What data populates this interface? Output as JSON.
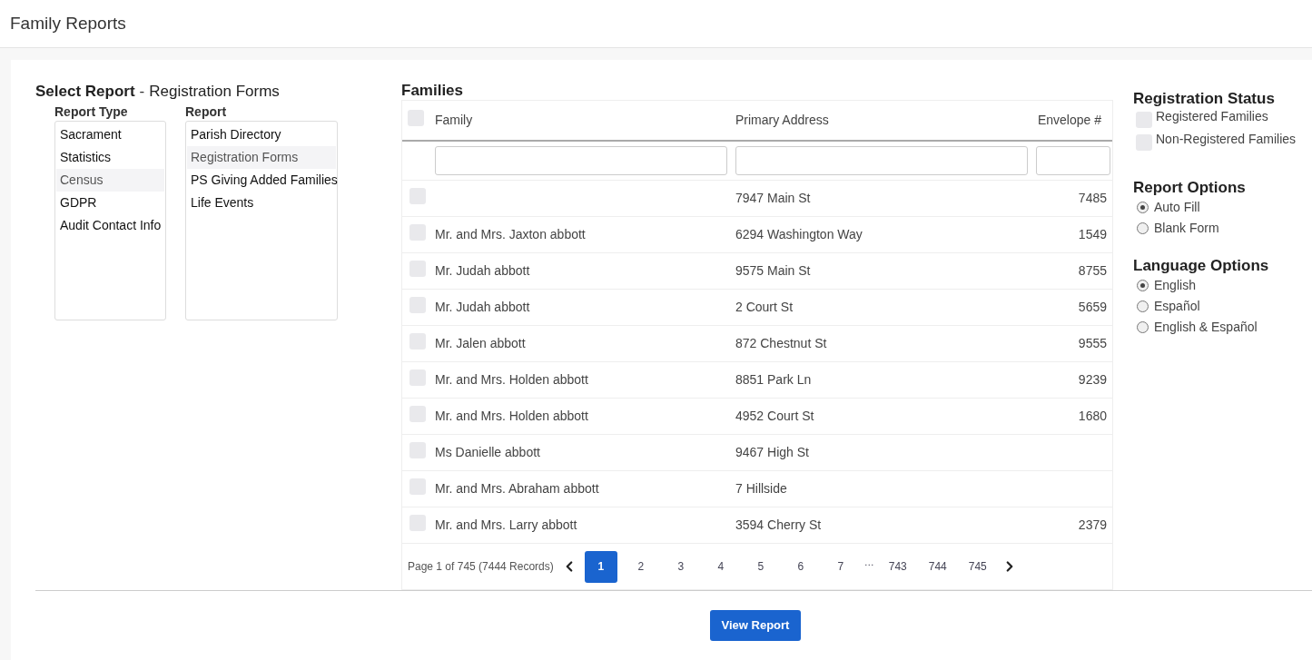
{
  "page_title": "Family Reports",
  "select_report": {
    "heading": "Select Report",
    "separator": "-",
    "current": "Registration Forms",
    "report_type": {
      "label": "Report Type",
      "items": [
        {
          "label": "Sacrament",
          "selected": false
        },
        {
          "label": "Statistics",
          "selected": false
        },
        {
          "label": "Census",
          "selected": true
        },
        {
          "label": "GDPR",
          "selected": false
        },
        {
          "label": "Audit Contact Info",
          "selected": false
        }
      ]
    },
    "report": {
      "label": "Report",
      "items": [
        {
          "label": "Parish Directory",
          "selected": false
        },
        {
          "label": "Registration Forms",
          "selected": true
        },
        {
          "label": "PS Giving Added Families",
          "selected": false
        },
        {
          "label": "Life Events",
          "selected": false
        }
      ]
    }
  },
  "families": {
    "title": "Families",
    "select_all_checked": false,
    "columns": [
      "Family",
      "Primary Address",
      "Envelope #"
    ],
    "rows": [
      {
        "family": "",
        "address": "7947 Main St",
        "envelope": "7485",
        "checked": false
      },
      {
        "family": "Mr. and Mrs. Jaxton abbott",
        "address": "6294 Washington Way",
        "envelope": "1549",
        "checked": false
      },
      {
        "family": "Mr. Judah abbott",
        "address": "9575 Main St",
        "envelope": "8755",
        "checked": false
      },
      {
        "family": "Mr. Judah abbott",
        "address": "2 Court St",
        "envelope": "5659",
        "checked": false
      },
      {
        "family": "Mr. Jalen abbott",
        "address": "872 Chestnut St",
        "envelope": "9555",
        "checked": false
      },
      {
        "family": "Mr. and Mrs. Holden abbott",
        "address": "8851 Park Ln",
        "envelope": "9239",
        "checked": false
      },
      {
        "family": "Mr. and Mrs. Holden abbott",
        "address": "4952 Court St",
        "envelope": "1680",
        "checked": false
      },
      {
        "family": "Ms Danielle abbott",
        "address": "9467 High St",
        "envelope": "",
        "checked": false
      },
      {
        "family": "Mr. and Mrs. Abraham abbott",
        "address": "7 Hillside",
        "envelope": "",
        "checked": false
      },
      {
        "family": "Mr. and Mrs. Larry abbott",
        "address": "3594 Cherry St",
        "envelope": "2379",
        "checked": false
      }
    ],
    "pager": {
      "summary": "Page 1 of 745 (7444 Records)",
      "pages": [
        {
          "label": "1",
          "kind": "page",
          "selected": true
        },
        {
          "label": "2",
          "kind": "page",
          "selected": false
        },
        {
          "label": "3",
          "kind": "page",
          "selected": false
        },
        {
          "label": "4",
          "kind": "page",
          "selected": false
        },
        {
          "label": "5",
          "kind": "page",
          "selected": false
        },
        {
          "label": "6",
          "kind": "page",
          "selected": false
        },
        {
          "label": "7",
          "kind": "page",
          "selected": false
        },
        {
          "label": "…",
          "kind": "ellipsis"
        },
        {
          "label": "743",
          "kind": "page",
          "selected": false
        },
        {
          "label": "744",
          "kind": "page",
          "selected": false
        },
        {
          "label": "745",
          "kind": "page",
          "selected": false
        }
      ]
    }
  },
  "registration_status": {
    "title": "Registration Status",
    "options": [
      {
        "label": "Registered Families",
        "checked": false
      },
      {
        "label": "Non-Registered Families",
        "checked": false
      }
    ]
  },
  "report_options": {
    "title": "Report Options",
    "options": [
      {
        "label": "Auto Fill",
        "selected": true
      },
      {
        "label": "Blank Form",
        "selected": false
      }
    ]
  },
  "language_options": {
    "title": "Language Options",
    "options": [
      {
        "label": "English",
        "selected": true
      },
      {
        "label": "Español",
        "selected": false
      },
      {
        "label": "English & Español",
        "selected": false
      }
    ]
  },
  "view_button": "View Report"
}
